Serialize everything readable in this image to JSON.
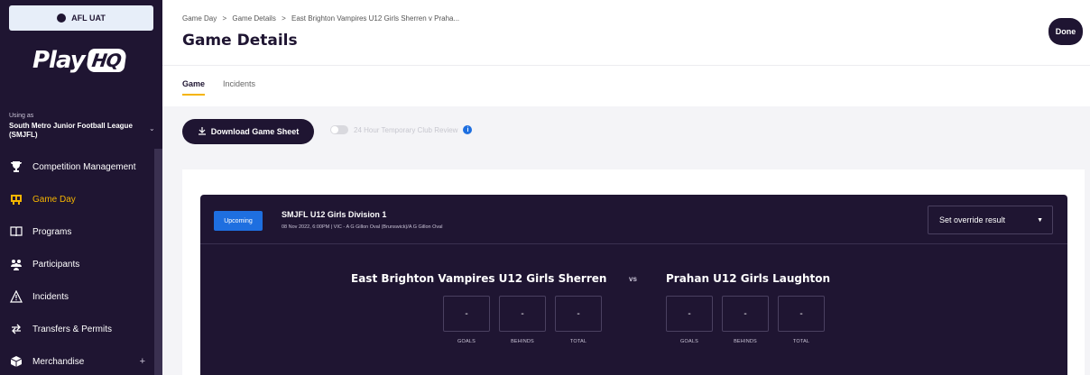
{
  "env": {
    "label": "AFL UAT"
  },
  "logo": {
    "text": "Play",
    "badge": "HQ"
  },
  "org": {
    "using_as": "Using as",
    "name": "South Metro Junior Football League (SMJFL)"
  },
  "sidebar": {
    "items": [
      {
        "label": "Competition Management",
        "icon": "trophy-icon"
      },
      {
        "label": "Game Day",
        "icon": "scoreboard-icon",
        "active": true
      },
      {
        "label": "Programs",
        "icon": "book-icon"
      },
      {
        "label": "Participants",
        "icon": "people-icon"
      },
      {
        "label": "Incidents",
        "icon": "warning-icon"
      },
      {
        "label": "Transfers & Permits",
        "icon": "transfer-icon"
      },
      {
        "label": "Merchandise",
        "icon": "merchandise-icon",
        "expand": "+"
      }
    ]
  },
  "header": {
    "breadcrumb": [
      "Game Day",
      "Game Details",
      "East Brighton Vampires U12 Girls Sherren v Praha..."
    ],
    "breadcrumb_sep": ">",
    "title": "Game Details",
    "done_label": "Done",
    "tabs": [
      {
        "label": "Game",
        "active": true
      },
      {
        "label": "Incidents",
        "active": false
      }
    ]
  },
  "toolbar": {
    "download_label": "Download Game Sheet",
    "toggle_label": "24 Hour Temporary Club Review",
    "info": "i"
  },
  "game": {
    "status": "Upcoming",
    "division": "SMJFL U12 Girls Division 1",
    "meta": "08 Nov 2022, 6:00PM | VIC - A G Gillon Oval (Brunswick)/A G Gillon Oval",
    "override_label": "Set override result",
    "vs": "vs",
    "home": {
      "name": "East Brighton Vampires U12 Girls Sherren",
      "scores": [
        {
          "value": "-",
          "label": "GOALS"
        },
        {
          "value": "-",
          "label": "BEHINDS"
        },
        {
          "value": "-",
          "label": "TOTAL"
        }
      ]
    },
    "away": {
      "name": "Prahan U12 Girls Laughton",
      "scores": [
        {
          "value": "-",
          "label": "GOALS"
        },
        {
          "value": "-",
          "label": "BEHINDS"
        },
        {
          "value": "-",
          "label": "TOTAL"
        }
      ]
    }
  }
}
